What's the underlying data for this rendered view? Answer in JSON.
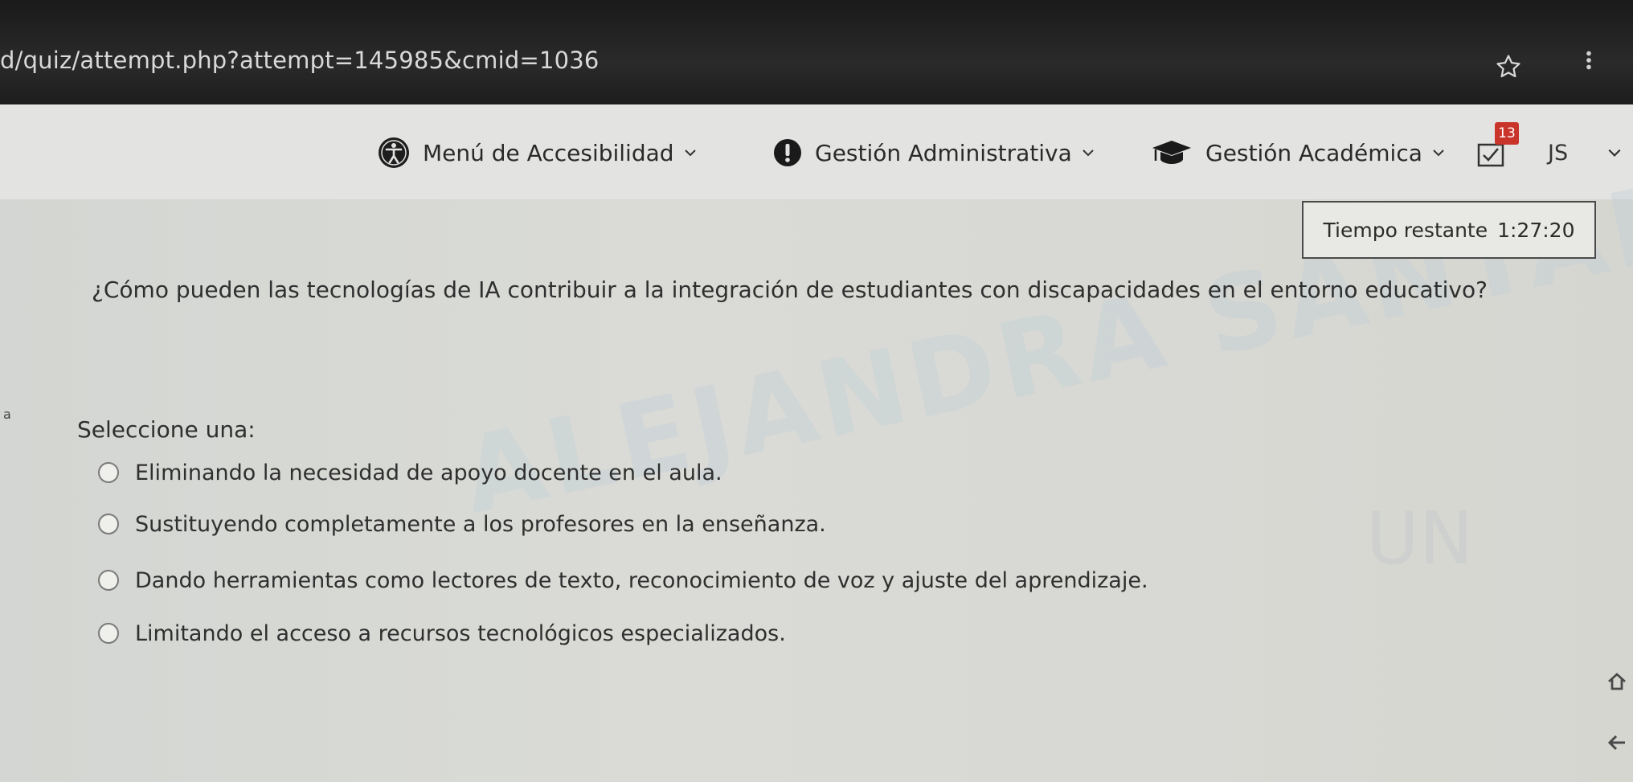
{
  "browser": {
    "url": "d/quiz/attempt.php?attempt=145985&cmid=1036",
    "star_icon": "star-icon"
  },
  "nav": {
    "accessibility_label": "Menú de Accesibilidad",
    "admin_label": "Gestión Administrativa",
    "academic_label": "Gestión Académica",
    "notification_count": "13",
    "user_initials": "JS",
    "icons": [
      "accessibility-icon",
      "alert-icon",
      "graduation-cap-icon",
      "notification-icon",
      "chevron-down-icon"
    ]
  },
  "quiz": {
    "timer_label": "Tiempo restante",
    "timer_value": "1:27:20",
    "question": "¿Cómo pueden las tecnologías de IA contribuir a la integración de estudiantes con discapacidades en el entorno educativo?",
    "side_mark": "a",
    "select_label": "Seleccione una:",
    "options": [
      "Eliminando la necesidad de apoyo docente en el aula.",
      "Sustituyendo completamente a los profesores en la enseñanza.",
      "Dando herramientas como lectores de texto, reconocimiento de voz y ajuste del aprendizaje.",
      "Limitando el acceso a recursos tecnológicos especializados."
    ],
    "watermark": "ALEJANDRA SANTANA",
    "watermark_right": "UN"
  },
  "colors": {
    "page_bg": "#d6d6d2",
    "nav_bg": "#e3e4e2",
    "badge": "#c9342b",
    "url_bar": "#1f1f1f"
  }
}
